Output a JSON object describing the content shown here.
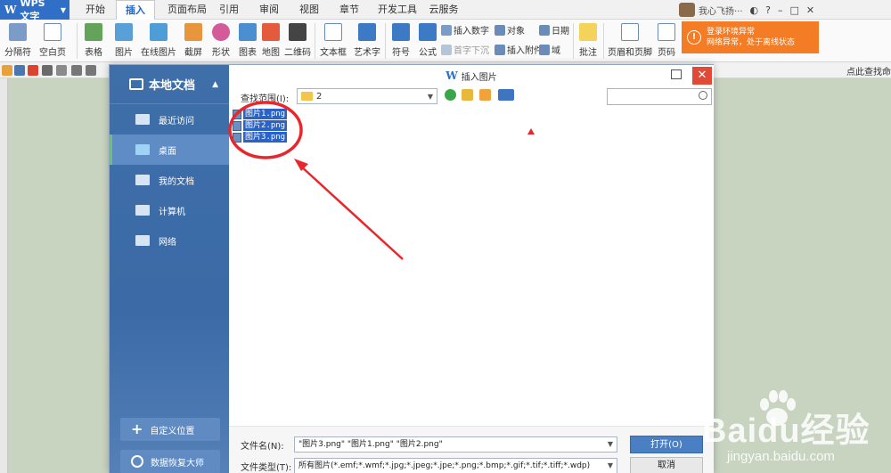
{
  "app": {
    "name": "WPS 文字"
  },
  "tabs": [
    "开始",
    "插入",
    "页面布局",
    "引用",
    "审阅",
    "视图",
    "章节",
    "开发工具",
    "云服务"
  ],
  "active_tab": "插入",
  "user": {
    "name": "我心飞扬···"
  },
  "ribbon": {
    "page_break": "分隔符",
    "blank_page": "空白页",
    "table": "表格",
    "picture": "图片",
    "online_picture": "在线图片",
    "screenshot": "截屏",
    "shape": "形状",
    "chart": "图表",
    "map": "地图",
    "qrcode": "二维码",
    "textbox": "文本框",
    "wordart": "艺术字",
    "symbol": "符号",
    "formula": "公式",
    "insert_number": "插入数字",
    "object": "对象",
    "date": "日期",
    "dropcap": "首字下沉",
    "attachment": "插入附件",
    "field": "域",
    "comment": "批注",
    "header_footer": "页眉和页脚",
    "page_number": "页码"
  },
  "toast": {
    "title": "登录环境异常",
    "message": "网络异常，处于离线状态",
    "icon": "alert-icon"
  },
  "quickbar": {
    "right_text": "点此查找命"
  },
  "dialog": {
    "title": "插入图片",
    "sidebar_title": "本地文档",
    "side_items": [
      "最近访问",
      "桌面",
      "我的文档",
      "计算机",
      "网络"
    ],
    "active_side_item": "桌面",
    "custom_location": "自定义位置",
    "data_recovery": "数据恢复大师",
    "lookin_label": "查找范围(I):",
    "lookin_value": "2",
    "files": [
      "图片1.png",
      "图片2.png",
      "图片3.png"
    ],
    "filename_label": "文件名(N):",
    "filename_value": "\"图片3.png\" \"图片1.png\" \"图片2.png\"",
    "filetype_label": "文件类型(T):",
    "filetype_value": "所有图片(*.emf;*.wmf;*.jpg;*.jpeg;*.jpe;*.png;*.bmp;*.gif;*.tif;*.tiff;*.wdp)",
    "open_button": "打开(O)",
    "cancel_button": "取消"
  },
  "watermark": {
    "text": "Baidu经验",
    "url": "jingyan.baidu.com"
  },
  "colors": {
    "accent": "#2f6fc7",
    "toast": "#f37c24",
    "sidebar": "#3f6fa9",
    "close": "#e04a37",
    "annotation": "#e8262b"
  }
}
